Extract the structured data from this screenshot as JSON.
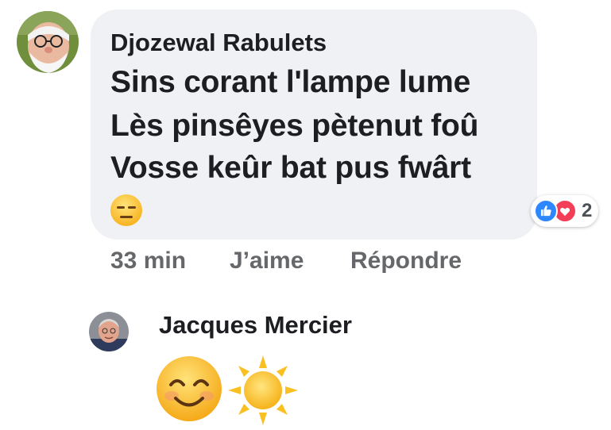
{
  "comment1": {
    "author": "Djozewal Rabulets",
    "lines": [
      "Sins corant l'lampe lume",
      "Lès pinsêyes pètenut foû",
      "Vosse keûr bat pus fwârt"
    ],
    "emoji": "expressionless-face-emoji",
    "reactions": {
      "icons": [
        "like-icon",
        "love-icon"
      ],
      "count": "2"
    },
    "meta": {
      "time": "33 min",
      "like": "J’aime",
      "reply": "Répondre"
    }
  },
  "comment2": {
    "author": "Jacques Mercier",
    "emojis": [
      "smiling-face-emoji",
      "sun-emoji"
    ]
  },
  "colors": {
    "bubble": "#f0f1f4",
    "text": "#1c1e21",
    "meta": "#65676b",
    "like": "#2d88ff",
    "love": "#f33e58"
  }
}
